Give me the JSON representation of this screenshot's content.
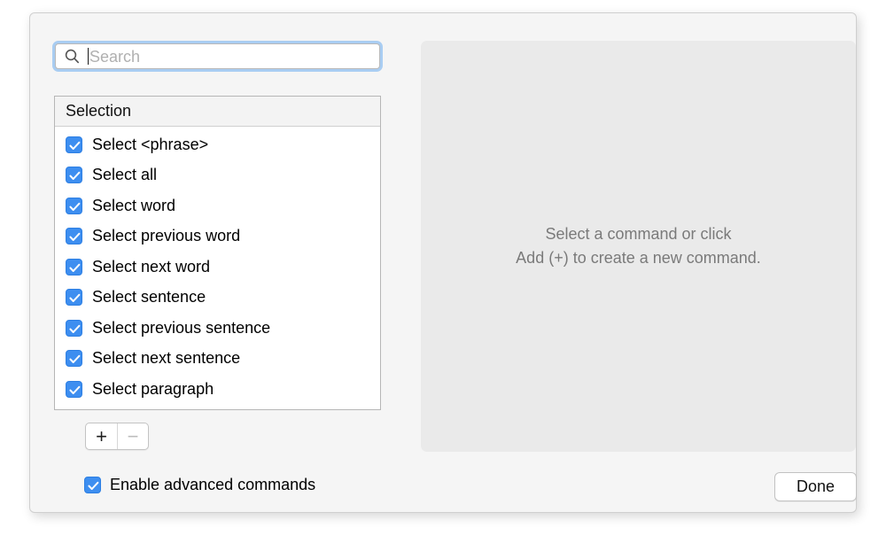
{
  "search": {
    "placeholder": "Search",
    "value": "",
    "icon": "search-icon"
  },
  "list": {
    "group_header": "Selection",
    "items": [
      {
        "label": "Select <phrase>",
        "checked": true
      },
      {
        "label": "Select all",
        "checked": true
      },
      {
        "label": "Select word",
        "checked": true
      },
      {
        "label": "Select previous word",
        "checked": true
      },
      {
        "label": "Select next word",
        "checked": true
      },
      {
        "label": "Select sentence",
        "checked": true
      },
      {
        "label": "Select previous sentence",
        "checked": true
      },
      {
        "label": "Select next sentence",
        "checked": true
      },
      {
        "label": "Select paragraph",
        "checked": true
      }
    ]
  },
  "segmented": {
    "add_label": "+",
    "remove_label": "−",
    "remove_disabled": true
  },
  "detail": {
    "empty_line1": "Select a command or click",
    "empty_line2": "Add (+) to create a new command."
  },
  "footer": {
    "advanced_label": "Enable advanced commands",
    "advanced_checked": true,
    "done_label": "Done"
  },
  "colors": {
    "accent": "#3d8ef0",
    "focus_ring": "#a9cdf2",
    "sheet_bg": "#f5f5f5",
    "panel_bg": "#eaeaea",
    "placeholder_text": "#7a7a7a"
  }
}
